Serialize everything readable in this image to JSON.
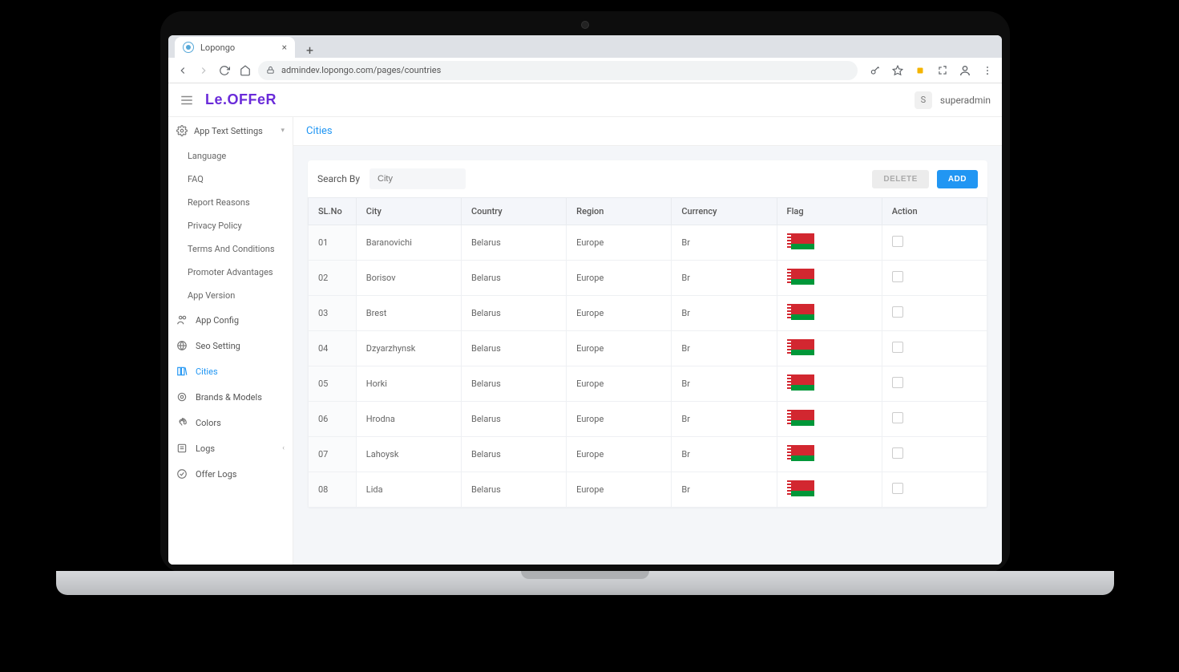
{
  "browser": {
    "tab_title": "Lopongo",
    "url": "admindev.lopongo.com/pages/countries"
  },
  "header": {
    "brand": "Le.OFFeR",
    "user_initial": "S",
    "user_name": "superadmin"
  },
  "sidebar": {
    "group": {
      "label": "App Text Settings"
    },
    "group_children": [
      {
        "label": "Language"
      },
      {
        "label": "FAQ"
      },
      {
        "label": "Report Reasons"
      },
      {
        "label": "Privacy Policy"
      },
      {
        "label": "Terms And Conditions"
      },
      {
        "label": "Promoter Advantages"
      },
      {
        "label": "App Version"
      }
    ],
    "items": [
      {
        "label": "App Config"
      },
      {
        "label": "Seo Setting"
      },
      {
        "label": "Cities"
      },
      {
        "label": "Brands & Models"
      },
      {
        "label": "Colors"
      },
      {
        "label": "Logs"
      },
      {
        "label": "Offer Logs"
      }
    ]
  },
  "page": {
    "title": "Cities",
    "search_label": "Search By",
    "search_placeholder": "City",
    "delete_label": "DELETE",
    "add_label": "ADD"
  },
  "table": {
    "columns": {
      "sl": "SL.No",
      "city": "City",
      "country": "Country",
      "region": "Region",
      "currency": "Currency",
      "flag": "Flag",
      "action": "Action"
    },
    "rows": [
      {
        "sl": "01",
        "city": "Baranovichi",
        "country": "Belarus",
        "region": "Europe",
        "currency": "Br",
        "flag": "belarus"
      },
      {
        "sl": "02",
        "city": "Borisov",
        "country": "Belarus",
        "region": "Europe",
        "currency": "Br",
        "flag": "belarus"
      },
      {
        "sl": "03",
        "city": "Brest",
        "country": "Belarus",
        "region": "Europe",
        "currency": "Br",
        "flag": "belarus"
      },
      {
        "sl": "04",
        "city": "Dzyarzhynsk",
        "country": "Belarus",
        "region": "Europe",
        "currency": "Br",
        "flag": "belarus"
      },
      {
        "sl": "05",
        "city": "Horki",
        "country": "Belarus",
        "region": "Europe",
        "currency": "Br",
        "flag": "belarus"
      },
      {
        "sl": "06",
        "city": "Hrodna",
        "country": "Belarus",
        "region": "Europe",
        "currency": "Br",
        "flag": "belarus"
      },
      {
        "sl": "07",
        "city": "Lahoysk",
        "country": "Belarus",
        "region": "Europe",
        "currency": "Br",
        "flag": "belarus"
      },
      {
        "sl": "08",
        "city": "Lida",
        "country": "Belarus",
        "region": "Europe",
        "currency": "Br",
        "flag": "belarus"
      }
    ]
  }
}
